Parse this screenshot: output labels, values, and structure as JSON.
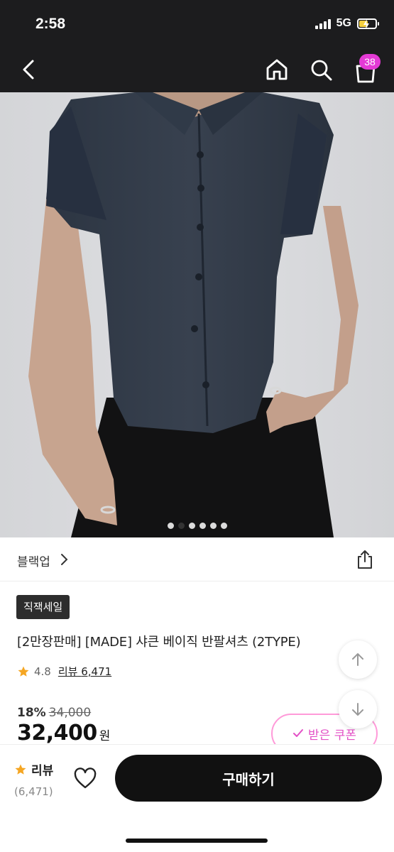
{
  "status_bar": {
    "time": "2:58",
    "network": "5G",
    "battery_level": 0.4
  },
  "header": {
    "cart_count": "38",
    "badge_color": "#e43ad5"
  },
  "gallery": {
    "image_count": 6,
    "active_index": 1
  },
  "brand": {
    "name": "블랙업"
  },
  "product": {
    "tag": "직잭세일",
    "title": "[2만장판매] [MADE] 샤큰 베이직 반팔셔츠 (2TYPE)",
    "rating": "4.8",
    "review_label": "리뷰",
    "review_count": "6,471",
    "discount": "18%",
    "original_price": "34,000",
    "sale_price": "32,400",
    "currency": "원"
  },
  "coupon": {
    "label": "받은 쿠폰",
    "accent": "#e34fc6"
  },
  "bottom_bar": {
    "review_label": "리뷰",
    "review_count": "(6,471)",
    "buy_label": "구매하기"
  },
  "icons": [
    "back-icon",
    "home-icon",
    "search-icon",
    "cart-icon",
    "share-icon",
    "star-icon",
    "heart-icon",
    "arrow-up-icon",
    "arrow-down-icon",
    "check-icon"
  ]
}
